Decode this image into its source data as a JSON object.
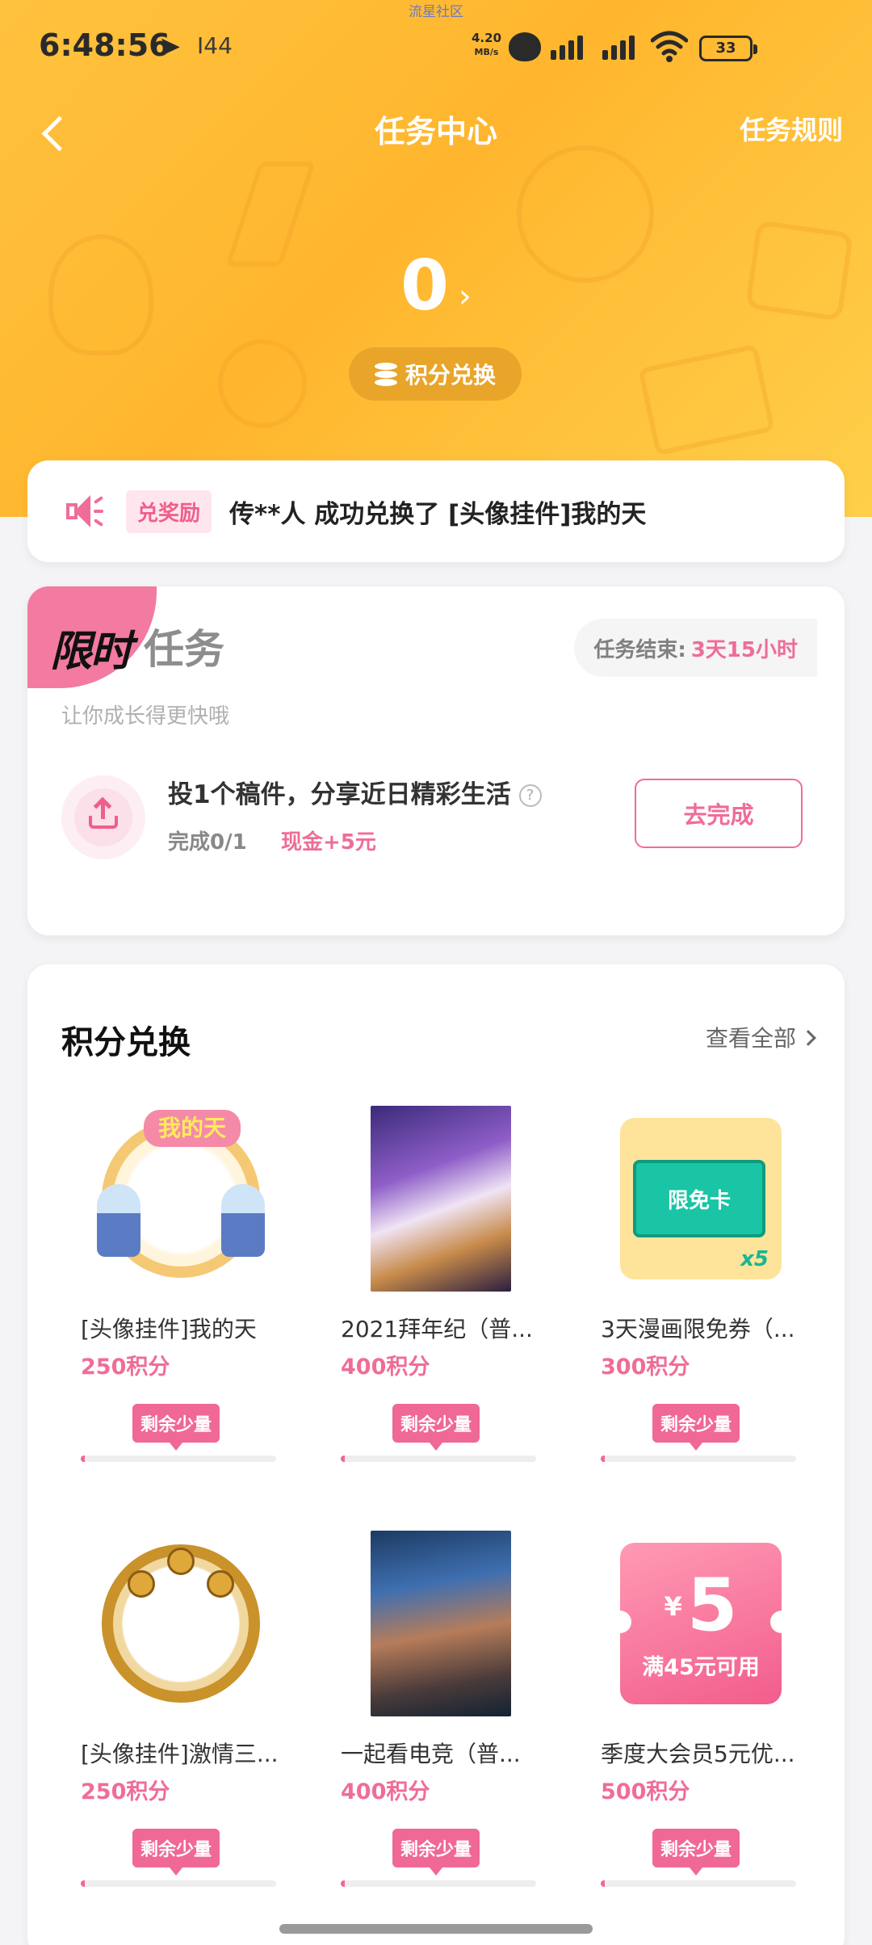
{
  "status_bar": {
    "top_label": "流星社区",
    "time": "6:48:56",
    "extra": "I44",
    "net_speed_value": "4.20",
    "net_speed_unit": "MB/s",
    "battery": "33"
  },
  "header": {
    "title": "任务中心",
    "rules_label": "任务规则",
    "points": "0",
    "exchange_label": "积分兑换"
  },
  "notice": {
    "tag": "兑奖励",
    "text": "传**人 成功兑换了 [头像挂件]我的天"
  },
  "limited_task": {
    "badge": "限时",
    "title": "任务",
    "subtitle": "让你成长得更快哦",
    "end_label": "任务结束:",
    "end_value": "3天15小时",
    "task": {
      "name": "投1个稿件，分享近日精彩生活",
      "help": "?",
      "progress": "完成0/1",
      "reward": "现金+5元",
      "button": "去完成"
    }
  },
  "shop": {
    "title": "积分兑换",
    "see_all": "查看全部",
    "items": [
      {
        "name": "[头像挂件]我的天",
        "price": "250积分",
        "stock": "剩余少量",
        "remaining": 0.02,
        "frame_text": "我的天"
      },
      {
        "name": "2021拜年纪（普...",
        "price": "400积分",
        "stock": "剩余少量",
        "remaining": 0.02
      },
      {
        "name": "3天漫画限免券（...",
        "price": "300积分",
        "stock": "剩余少量",
        "remaining": 0.02,
        "card_text": "限免卡",
        "card_multiplier": "x5"
      },
      {
        "name": "[头像挂件]激情三...",
        "price": "250积分",
        "stock": "剩余少量",
        "remaining": 0.02
      },
      {
        "name": "一起看电竞（普...",
        "price": "400积分",
        "stock": "剩余少量",
        "remaining": 0.02
      },
      {
        "name": "季度大会员5元优...",
        "price": "500积分",
        "stock": "剩余少量",
        "remaining": 0.02,
        "coupon_currency": "¥",
        "coupon_amount": "5",
        "coupon_condition": "满45元可用"
      }
    ]
  }
}
